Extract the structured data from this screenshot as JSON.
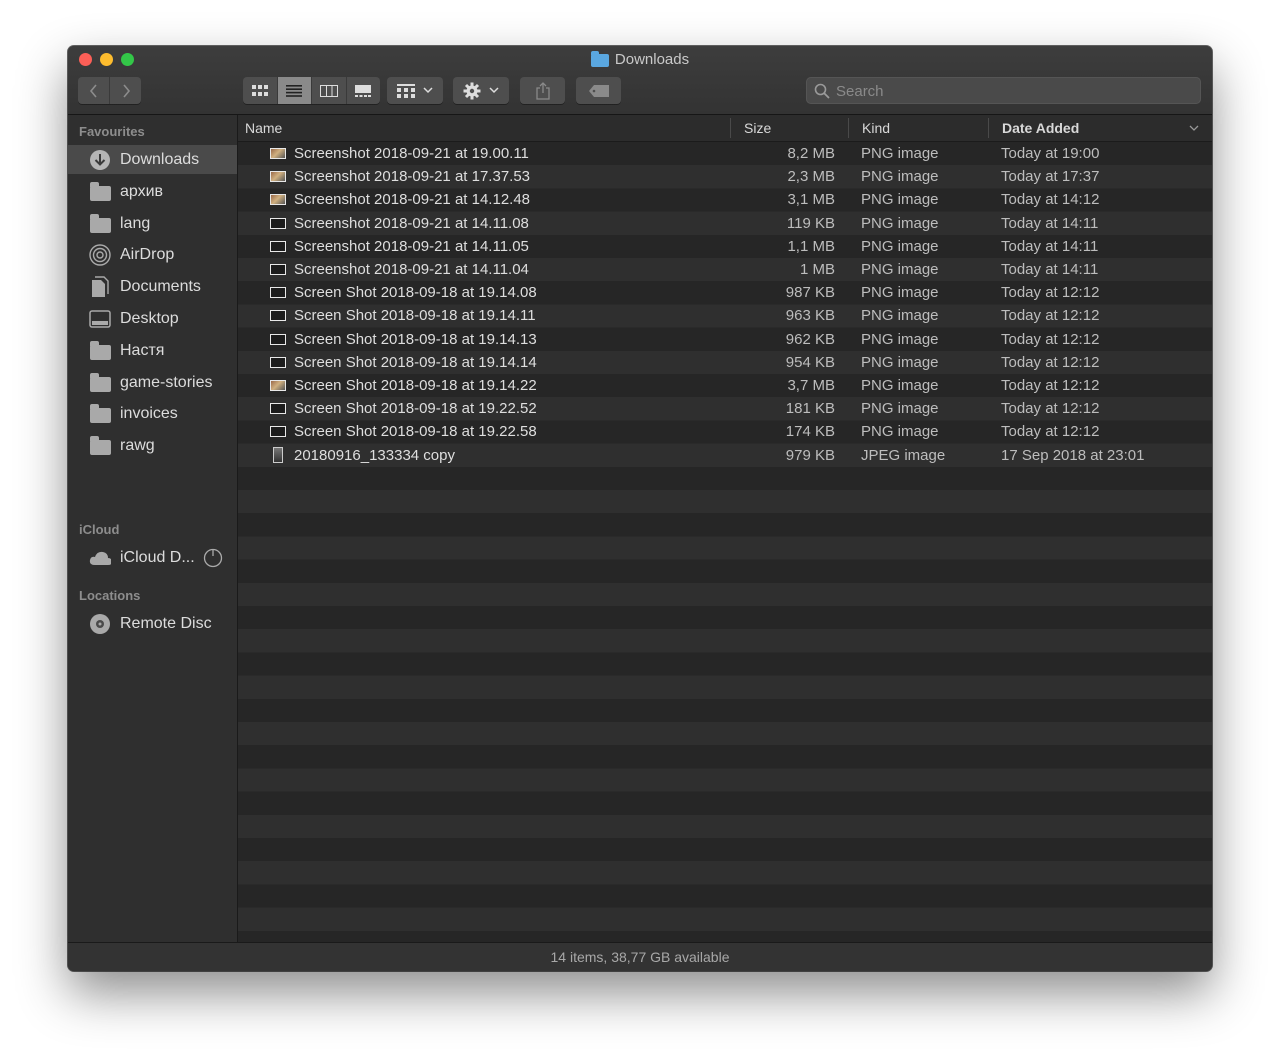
{
  "window": {
    "title": "Downloads"
  },
  "toolbar": {
    "back_icon": "chevron-left",
    "forward_icon": "chevron-right",
    "view_modes": [
      "icon-view",
      "list-view",
      "column-view",
      "gallery-view"
    ],
    "active_view": "list-view",
    "group_icon": "group-by",
    "action_icon": "gear",
    "share_icon": "share",
    "tag_icon": "tag",
    "search_placeholder": "Search"
  },
  "sidebar": {
    "favourites_header": "Favourites",
    "favourites": [
      {
        "label": "Downloads",
        "icon": "downloads-icon",
        "selected": true
      },
      {
        "label": "архив",
        "icon": "folder-icon"
      },
      {
        "label": "lang",
        "icon": "folder-icon"
      },
      {
        "label": "AirDrop",
        "icon": "airdrop-icon"
      },
      {
        "label": "Documents",
        "icon": "documents-icon"
      },
      {
        "label": "Desktop",
        "icon": "desktop-icon"
      },
      {
        "label": "Настя",
        "icon": "folder-icon"
      },
      {
        "label": "game-stories",
        "icon": "folder-icon"
      },
      {
        "label": "invoices",
        "icon": "folder-icon"
      },
      {
        "label": "rawg",
        "icon": "folder-icon"
      }
    ],
    "icloud_header": "iCloud",
    "icloud": [
      {
        "label": "iCloud D...",
        "icon": "cloud-icon"
      }
    ],
    "locations_header": "Locations",
    "locations": [
      {
        "label": "Remote Disc",
        "icon": "disc-icon"
      }
    ]
  },
  "columns": {
    "name": "Name",
    "size": "Size",
    "kind": "Kind",
    "date": "Date Added"
  },
  "files": [
    {
      "name": "Screenshot 2018-09-21 at 19.00.11",
      "size": "8,2 MB",
      "kind": "PNG image",
      "date": "Today at 19:00",
      "thumb": "photo"
    },
    {
      "name": "Screenshot 2018-09-21 at 17.37.53",
      "size": "2,3 MB",
      "kind": "PNG image",
      "date": "Today at 17:37",
      "thumb": "photo"
    },
    {
      "name": "Screenshot 2018-09-21 at 14.12.48",
      "size": "3,1 MB",
      "kind": "PNG image",
      "date": "Today at 14:12",
      "thumb": "photo"
    },
    {
      "name": "Screenshot 2018-09-21 at 14.11.08",
      "size": "119 KB",
      "kind": "PNG image",
      "date": "Today at 14:11",
      "thumb": "plain"
    },
    {
      "name": "Screenshot 2018-09-21 at 14.11.05",
      "size": "1,1 MB",
      "kind": "PNG image",
      "date": "Today at 14:11",
      "thumb": "plain"
    },
    {
      "name": "Screenshot 2018-09-21 at 14.11.04",
      "size": "1 MB",
      "kind": "PNG image",
      "date": "Today at 14:11",
      "thumb": "plain"
    },
    {
      "name": "Screen Shot 2018-09-18 at 19.14.08",
      "size": "987 KB",
      "kind": "PNG image",
      "date": "Today at 12:12",
      "thumb": "plain"
    },
    {
      "name": "Screen Shot 2018-09-18 at 19.14.11",
      "size": "963 KB",
      "kind": "PNG image",
      "date": "Today at 12:12",
      "thumb": "plain"
    },
    {
      "name": "Screen Shot 2018-09-18 at 19.14.13",
      "size": "962 KB",
      "kind": "PNG image",
      "date": "Today at 12:12",
      "thumb": "plain"
    },
    {
      "name": "Screen Shot 2018-09-18 at 19.14.14",
      "size": "954 KB",
      "kind": "PNG image",
      "date": "Today at 12:12",
      "thumb": "plain"
    },
    {
      "name": "Screen Shot 2018-09-18 at 19.14.22",
      "size": "3,7 MB",
      "kind": "PNG image",
      "date": "Today at 12:12",
      "thumb": "photo"
    },
    {
      "name": "Screen Shot 2018-09-18 at 19.22.52",
      "size": "181 KB",
      "kind": "PNG image",
      "date": "Today at 12:12",
      "thumb": "plain"
    },
    {
      "name": "Screen Shot 2018-09-18 at 19.22.58",
      "size": "174 KB",
      "kind": "PNG image",
      "date": "Today at 12:12",
      "thumb": "plain"
    },
    {
      "name": "20180916_133334 copy",
      "size": "979 KB",
      "kind": "JPEG image",
      "date": "17 Sep 2018 at 23:01",
      "thumb": "jpeg"
    }
  ],
  "status": {
    "text": "14 items, 38,77 GB available"
  }
}
